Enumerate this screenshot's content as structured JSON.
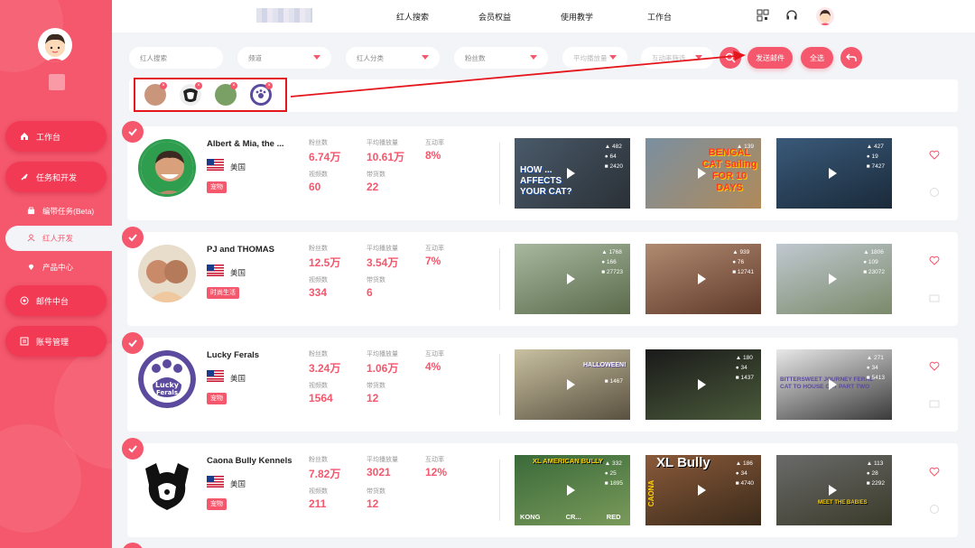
{
  "sidebar": {
    "nav": [
      {
        "label": "工作台",
        "icon": "home-icon"
      },
      {
        "label": "任务和开发",
        "icon": "rocket-icon"
      },
      {
        "label": "编带任务(Beta)",
        "icon": "bag-icon",
        "sub": true
      },
      {
        "label": "红人开发",
        "icon": "user-icon",
        "sub": true,
        "active": true
      },
      {
        "label": "产品中心",
        "icon": "location-icon",
        "sub": true
      },
      {
        "label": "邮件中台",
        "icon": "mail-icon"
      },
      {
        "label": "账号管理",
        "icon": "list-icon"
      }
    ]
  },
  "header": {
    "nav": [
      "红人搜索",
      "会员权益",
      "使用教学",
      "工作台"
    ]
  },
  "filters": {
    "search_placeholder": "红人搜索",
    "dropdowns": [
      "频道",
      "红人分类",
      "粉丝数",
      "平均播放量",
      "互动率筛选"
    ],
    "buttons": {
      "send_mail": "发送邮件",
      "select_all": "全选"
    }
  },
  "labels": {
    "followers": "粉丝数",
    "avg_views": "平均播放量",
    "engagement": "互动率",
    "videos": "视频数",
    "collabs": "带货数"
  },
  "influencers": [
    {
      "name": "Albert & Mia, the ...",
      "country": "美国",
      "tag": "宠物",
      "followers": "6.74万",
      "avg_views": "10.61万",
      "engagement": "8%",
      "videos": "60",
      "collabs": "22",
      "videos_list": [
        {
          "likes": "482",
          "comments": "64",
          "views": "2420"
        },
        {
          "likes": "139",
          "comments": "",
          "views": ""
        },
        {
          "likes": "427",
          "comments": "19",
          "views": "7427"
        }
      ]
    },
    {
      "name": "PJ and THOMAS",
      "country": "美国",
      "tag": "时尚生活",
      "followers": "12.5万",
      "avg_views": "3.54万",
      "engagement": "7%",
      "videos": "334",
      "collabs": "6",
      "videos_list": [
        {
          "likes": "1768",
          "comments": "166",
          "views": "27723"
        },
        {
          "likes": "939",
          "comments": "76",
          "views": "12741"
        },
        {
          "likes": "1806",
          "comments": "109",
          "views": "23072"
        }
      ]
    },
    {
      "name": "Lucky Ferals",
      "country": "美国",
      "tag": "宠物",
      "followers": "3.24万",
      "avg_views": "1.06万",
      "engagement": "4%",
      "videos": "1564",
      "collabs": "12",
      "videos_list": [
        {
          "likes": "",
          "comments": "",
          "views": "1467"
        },
        {
          "likes": "180",
          "comments": "34",
          "views": "1437"
        },
        {
          "likes": "271",
          "comments": "34",
          "views": "5413"
        }
      ]
    },
    {
      "name": "Caona Bully Kennels",
      "country": "美国",
      "tag": "宠物",
      "followers": "7.82万",
      "avg_views": "3021",
      "engagement": "12%",
      "videos": "211",
      "collabs": "12",
      "videos_list": [
        {
          "likes": "332",
          "comments": "25",
          "views": "1895"
        },
        {
          "likes": "186",
          "comments": "34",
          "views": "4740"
        },
        {
          "likes": "113",
          "comments": "28",
          "views": "2292"
        }
      ]
    }
  ],
  "thumb_texts": {
    "t1_1": "HOW ... AFFECTS YOUR CAT?",
    "t1_2": "BENGAL CAT Sailing FOR 10 DAYS",
    "t3_1": "HALLOWEEN!",
    "t3_3": "BITTERSWEET JOURNEY FERAL CAT TO HOUSE CAT PART TWO",
    "t4_1": "XL AMERICAN BULLY",
    "t4_1b": "KONG CR... RED",
    "t4_2": "XL Bully",
    "t4_2b": "CAONA",
    "t4_3": "MEET THE BABIES"
  },
  "colors": {
    "accent": "#f5576c",
    "sidebar": "#f5576c",
    "annotation": "#e4161c"
  }
}
